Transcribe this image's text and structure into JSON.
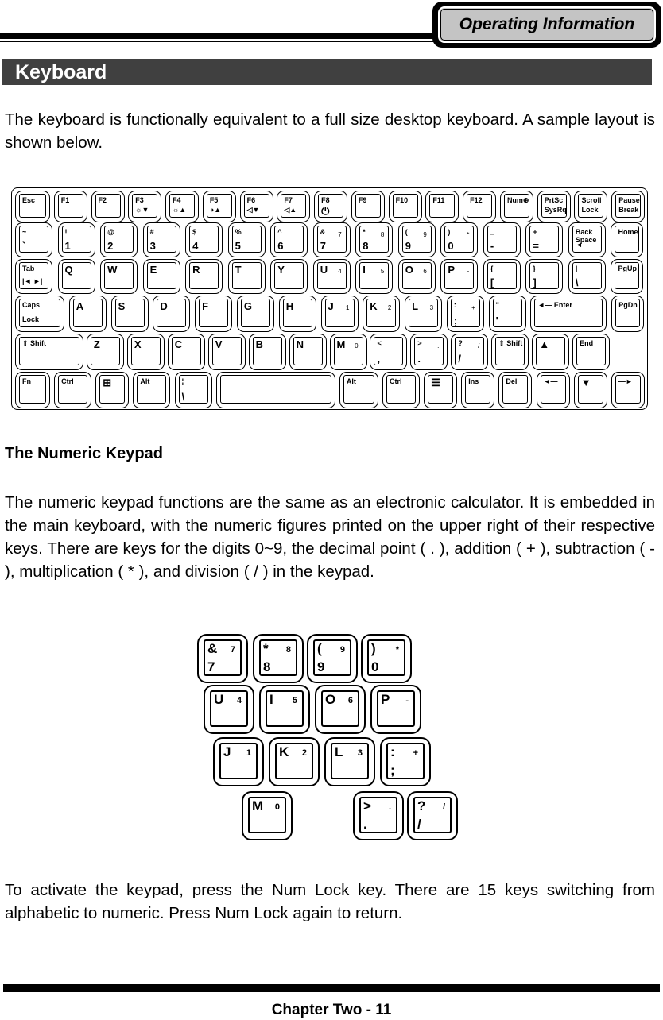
{
  "header": {
    "tab_label": "Operating Information"
  },
  "section": {
    "title": "Keyboard"
  },
  "intro": "The keyboard is functionally equivalent to a full size desktop keyboard. A sample layout is shown below.",
  "keyboard": {
    "rows": [
      [
        {
          "main": "Esc"
        },
        {
          "main": "F1"
        },
        {
          "main": "F2"
        },
        {
          "main": "F3",
          "sub": "☼▼"
        },
        {
          "main": "F4",
          "sub": "☼▲"
        },
        {
          "main": "F5",
          "sub": "◑▲"
        },
        {
          "main": "F6",
          "sub": "◁▼"
        },
        {
          "main": "F7",
          "sub": "◁▲"
        },
        {
          "main": "F8",
          "sub": "⏻"
        },
        {
          "main": "F9"
        },
        {
          "main": "F10"
        },
        {
          "main": "F11"
        },
        {
          "main": "F12"
        },
        {
          "main": "Num⊕"
        },
        {
          "main": "PrtSc",
          "sub": "SysRq"
        },
        {
          "main": "Scroll",
          "sub": "Lock"
        },
        {
          "main": "Pause",
          "sub": "Break"
        }
      ],
      [
        {
          "main": "~",
          "sub": "`"
        },
        {
          "main": "!",
          "sub": "1"
        },
        {
          "main": "@",
          "sub": "2"
        },
        {
          "main": "#",
          "sub": "3"
        },
        {
          "main": "$",
          "sub": "4"
        },
        {
          "main": "%",
          "sub": "5"
        },
        {
          "main": "^",
          "sub": "6"
        },
        {
          "main": "&",
          "sub": "7",
          "num": "7"
        },
        {
          "main": "*",
          "sub": "8",
          "num": "8"
        },
        {
          "main": "(",
          "sub": "9",
          "num": "9"
        },
        {
          "main": ")",
          "sub": "0",
          "num": "*"
        },
        {
          "main": "_",
          "sub": "-"
        },
        {
          "main": "+",
          "sub": "="
        },
        {
          "main": "Back Space",
          "sub": "◄—"
        },
        {
          "main": "Home"
        }
      ],
      [
        {
          "main": "Tab",
          "sub": "|◄ ►|"
        },
        {
          "main": "Q"
        },
        {
          "main": "W"
        },
        {
          "main": "E"
        },
        {
          "main": "R"
        },
        {
          "main": "T"
        },
        {
          "main": "Y"
        },
        {
          "main": "U",
          "num": "4"
        },
        {
          "main": "I",
          "num": "5"
        },
        {
          "main": "O",
          "num": "6"
        },
        {
          "main": "P",
          "num": "-"
        },
        {
          "main": "{",
          "sub": "["
        },
        {
          "main": "}",
          "sub": "]"
        },
        {
          "main": "|",
          "sub": "\\"
        },
        {
          "main": "PgUp"
        }
      ],
      [
        {
          "main": "Caps",
          "sub": "Lock"
        },
        {
          "main": "A"
        },
        {
          "main": "S"
        },
        {
          "main": "D"
        },
        {
          "main": "F"
        },
        {
          "main": "G"
        },
        {
          "main": "H"
        },
        {
          "main": "J",
          "num": "1"
        },
        {
          "main": "K",
          "num": "2"
        },
        {
          "main": "L",
          "num": "3"
        },
        {
          "main": ":",
          "sub": ";",
          "num": "+"
        },
        {
          "main": "\"",
          "sub": "'"
        },
        {
          "main": "◄— Enter"
        },
        {
          "main": "PgDn"
        }
      ],
      [
        {
          "main": "⇧ Shift"
        },
        {
          "main": "Z"
        },
        {
          "main": "X"
        },
        {
          "main": "C"
        },
        {
          "main": "V"
        },
        {
          "main": "B"
        },
        {
          "main": "N"
        },
        {
          "main": "M",
          "num": "0"
        },
        {
          "main": "<",
          "sub": ","
        },
        {
          "main": ">",
          "sub": ".",
          "num": "."
        },
        {
          "main": "?",
          "sub": "/",
          "num": "/"
        },
        {
          "main": "⇧ Shift"
        },
        {
          "main": "▲"
        },
        {
          "main": "End"
        }
      ],
      [
        {
          "main": "Fn"
        },
        {
          "main": "Ctrl"
        },
        {
          "main": "⊞"
        },
        {
          "main": "Alt"
        },
        {
          "main": "¦",
          "sub": "\\"
        },
        {
          "main": ""
        },
        {
          "main": "Alt"
        },
        {
          "main": "Ctrl"
        },
        {
          "main": "☰"
        },
        {
          "main": "Ins"
        },
        {
          "main": "Del"
        },
        {
          "main": "◄—"
        },
        {
          "main": "▼"
        },
        {
          "main": "—►"
        }
      ]
    ]
  },
  "numeric": {
    "title": "The Numeric Keypad",
    "desc": "The numeric keypad functions are the same as an electronic calculator. It is embedded in the main keyboard, with the numeric figures printed on the upper right of their respective keys. There are keys for the digits 0~9, the decimal point ( . ), addition ( + ), subtraction ( - ), multiplication ( * ), and division ( / ) in the keypad.",
    "keypad": [
      [
        {
          "main": "&",
          "sub": "7",
          "num": "7"
        },
        {
          "main": "*",
          "sub": "8",
          "num": "8"
        },
        {
          "main": "(",
          "sub": "9",
          "num": "9"
        },
        {
          "main": ")",
          "sub": "0",
          "num": "*"
        }
      ],
      [
        {
          "main": "U",
          "num": "4"
        },
        {
          "main": "I",
          "num": "5"
        },
        {
          "main": "O",
          "num": "6"
        },
        {
          "main": "P",
          "num": "-"
        }
      ],
      [
        {
          "main": "J",
          "num": "1"
        },
        {
          "main": "K",
          "num": "2"
        },
        {
          "main": "L",
          "num": "3"
        },
        {
          "main": ":",
          "sub": ";",
          "num": "+"
        }
      ],
      [
        {
          "main": "M",
          "num": "0"
        },
        {
          "main": ">",
          "sub": ".",
          "num": "."
        },
        {
          "main": "?",
          "sub": "/",
          "num": "/"
        }
      ]
    ],
    "activate": "To activate the keypad, press the Num Lock key. There are 15 keys switching from alphabetic to numeric. Press Num Lock again to return."
  },
  "footer": {
    "label": "Chapter Two - 11"
  }
}
